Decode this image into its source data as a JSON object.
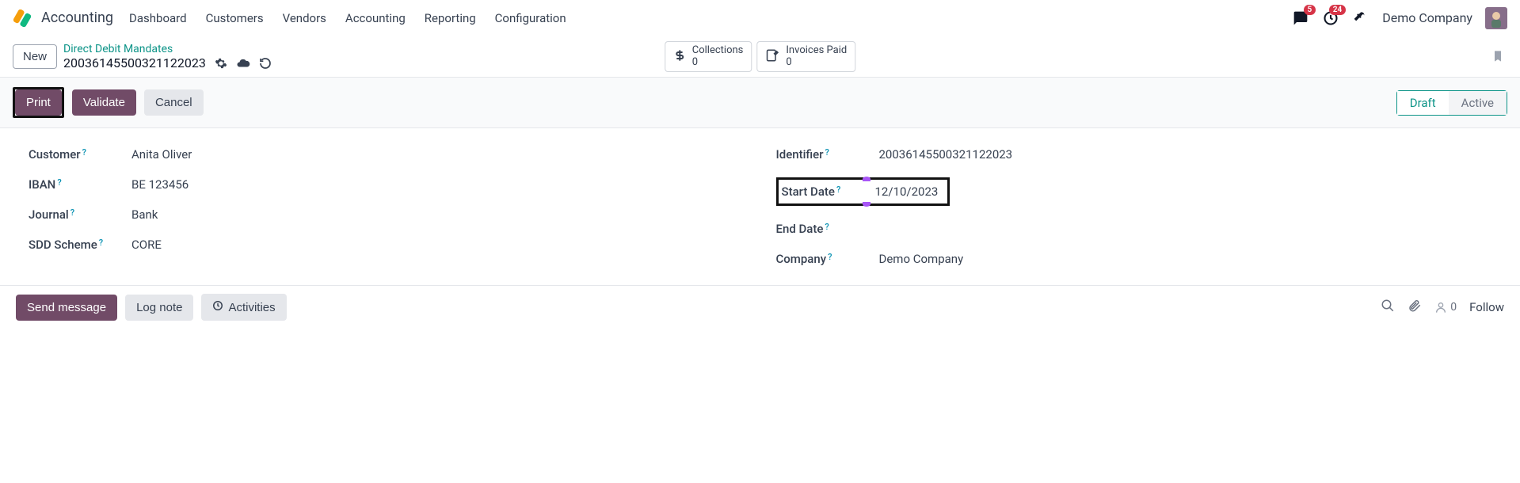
{
  "app_title": "Accounting",
  "nav": [
    "Dashboard",
    "Customers",
    "Vendors",
    "Accounting",
    "Reporting",
    "Configuration"
  ],
  "tray": {
    "chat_badge": "5",
    "activity_badge": "24"
  },
  "company": "Demo Company",
  "new_btn": "New",
  "breadcrumb": {
    "parent": "Direct Debit Mandates",
    "current": "20036145500321122023"
  },
  "stat1": {
    "label": "Collections",
    "value": "0"
  },
  "stat2": {
    "label": "Invoices Paid",
    "value": "0"
  },
  "actions": {
    "print": "Print",
    "validate": "Validate",
    "cancel": "Cancel"
  },
  "status": {
    "draft": "Draft",
    "active": "Active"
  },
  "left": {
    "customer_label": "Customer",
    "customer": "Anita Oliver",
    "iban_label": "IBAN",
    "iban": "BE 123456",
    "journal_label": "Journal",
    "journal": "Bank",
    "scheme_label": "SDD Scheme",
    "scheme": "CORE"
  },
  "right": {
    "identifier_label": "Identifier",
    "identifier": "20036145500321122023",
    "start_label": "Start Date",
    "start": "12/10/2023",
    "end_label": "End Date",
    "end": "",
    "company_label": "Company",
    "company": "Demo Company"
  },
  "chatter": {
    "send": "Send message",
    "log": "Log note",
    "activities": "Activities",
    "followers": "0",
    "follow": "Follow"
  }
}
